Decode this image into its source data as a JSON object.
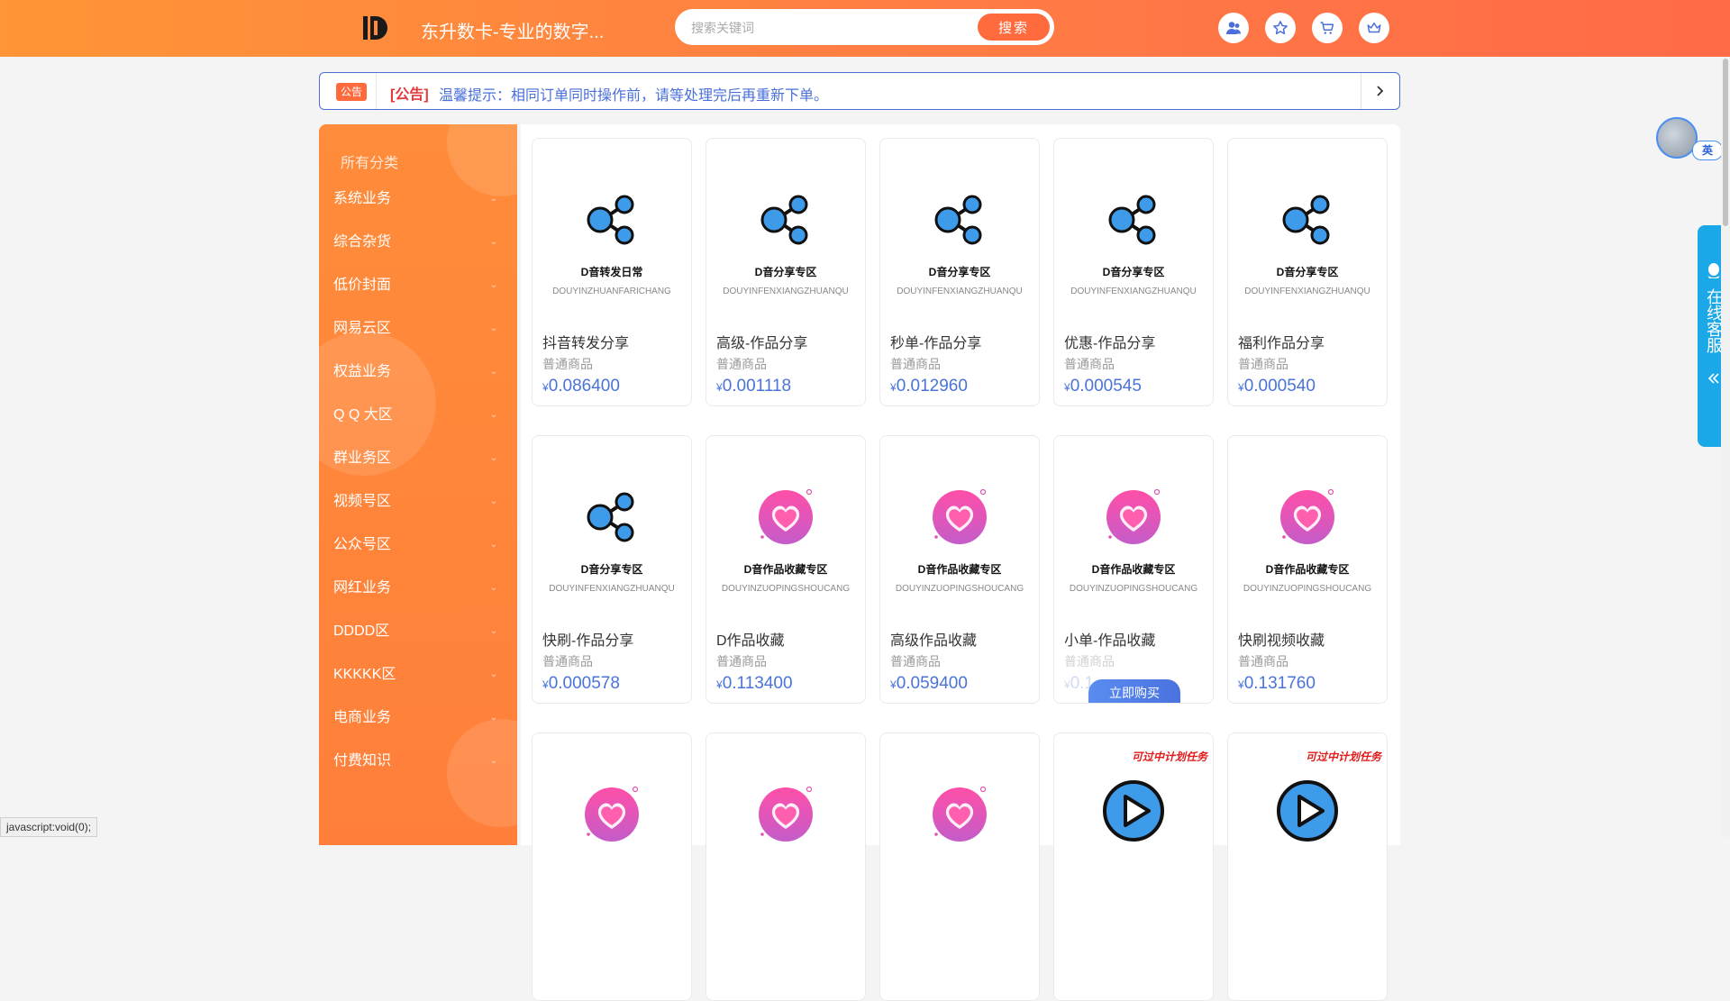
{
  "header": {
    "site_title": "东升数卡-专业的数字...",
    "search_placeholder": "搜索关键词",
    "search_button": "搜索"
  },
  "notice": {
    "badge": "公告",
    "tag": "[公告]",
    "text": "温馨提示：相同订单同时操作前，请等处理完后再重新下单。"
  },
  "sidebar": {
    "title": "所有分类",
    "items": [
      {
        "label": "系统业务"
      },
      {
        "label": "综合杂货"
      },
      {
        "label": "低价封面"
      },
      {
        "label": "网易云区"
      },
      {
        "label": "权益业务"
      },
      {
        "label": "Q Q 大区"
      },
      {
        "label": "群业务区"
      },
      {
        "label": "视频号区"
      },
      {
        "label": "公众号区"
      },
      {
        "label": "网红业务"
      },
      {
        "label": "DDDD区"
      },
      {
        "label": "KKKKK区"
      },
      {
        "label": "电商业务"
      },
      {
        "label": "付费知识"
      }
    ]
  },
  "products": [
    {
      "img_title": "D音转发日常",
      "img_sub": "DOUYINZHUANFARICHANG",
      "name": "抖音转发分享",
      "kind": "普通商品",
      "currency": "¥",
      "price": "0.086400",
      "icon": "share-icon"
    },
    {
      "img_title": "D音分享专区",
      "img_sub": "DOUYINFENXIANGZHUANQU",
      "name": "高级-作品分享",
      "kind": "普通商品",
      "currency": "¥",
      "price": "0.001118",
      "icon": "share-icon"
    },
    {
      "img_title": "D音分享专区",
      "img_sub": "DOUYINFENXIANGZHUANQU",
      "name": "秒单-作品分享",
      "kind": "普通商品",
      "currency": "¥",
      "price": "0.012960",
      "icon": "share-icon"
    },
    {
      "img_title": "D音分享专区",
      "img_sub": "DOUYINFENXIANGZHUANQU",
      "name": "优惠-作品分享",
      "kind": "普通商品",
      "currency": "¥",
      "price": "0.000545",
      "icon": "share-icon"
    },
    {
      "img_title": "D音分享专区",
      "img_sub": "DOUYINFENXIANGZHUANQU",
      "name": "福利作品分享",
      "kind": "普通商品",
      "currency": "¥",
      "price": "0.000540",
      "icon": "share-icon"
    },
    {
      "img_title": "D音分享专区",
      "img_sub": "DOUYINFENXIANGZHUANQU",
      "name": "快刷-作品分享",
      "kind": "普通商品",
      "currency": "¥",
      "price": "0.000578",
      "icon": "share-icon"
    },
    {
      "img_title": "D音作品收藏专区",
      "img_sub": "DOUYINZUOPINGSHOUCANG",
      "name": "D作品收藏",
      "kind": "普通商品",
      "currency": "¥",
      "price": "0.113400",
      "icon": "heart-icon"
    },
    {
      "img_title": "D音作品收藏专区",
      "img_sub": "DOUYINZUOPINGSHOUCANG",
      "name": "高级作品收藏",
      "kind": "普通商品",
      "currency": "¥",
      "price": "0.059400",
      "icon": "heart-icon"
    },
    {
      "img_title": "D音作品收藏专区",
      "img_sub": "DOUYINZUOPINGSHOUCANG",
      "name": "小单-作品收藏",
      "kind": "普通商品",
      "currency": "¥",
      "price": "0.1...",
      "icon": "heart-icon",
      "hover_button": "立即购买"
    },
    {
      "img_title": "D音作品收藏专区",
      "img_sub": "DOUYINZUOPINGSHOUCANG",
      "name": "快刷视频收藏",
      "kind": "普通商品",
      "currency": "¥",
      "price": "0.131760",
      "icon": "heart-icon"
    },
    {
      "icon": "heart-icon"
    },
    {
      "icon": "heart-icon"
    },
    {
      "icon": "heart-icon"
    },
    {
      "icon": "play-icon",
      "tag": "可过中计划任务"
    },
    {
      "icon": "play-icon",
      "tag": "可过中计划任务"
    }
  ],
  "float": {
    "lang": "英",
    "customer_service": "在线客服"
  },
  "status_bar": "javascript:void(0);",
  "colors": {
    "header_from": "#ff9536",
    "header_to": "#ff6a48",
    "accent": "#ff6b3d",
    "price": "#4a73d8",
    "notice": "#4a6fd8",
    "cs": "#1ba8e8"
  }
}
